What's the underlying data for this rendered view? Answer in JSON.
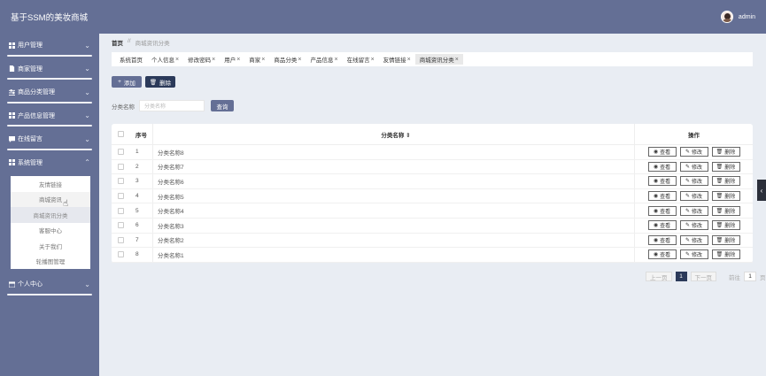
{
  "app": {
    "title": "基于SSM的美妆商城",
    "user": "admin"
  },
  "sidebar": {
    "items": [
      {
        "label": "用户管理",
        "icon": "grid-icon"
      },
      {
        "label": "商家管理",
        "icon": "file-icon"
      },
      {
        "label": "商品分类管理",
        "icon": "sliders-icon"
      },
      {
        "label": "产品信息管理",
        "icon": "grid-icon"
      },
      {
        "label": "在线留言",
        "icon": "chat-icon"
      },
      {
        "label": "系统管理",
        "icon": "grid-icon"
      },
      {
        "label": "个人中心",
        "icon": "calendar-icon"
      }
    ],
    "submenu": [
      "友情链接",
      "商城资讯",
      "商城资讯分类",
      "客服中心",
      "关于我们",
      "轮播图管理"
    ]
  },
  "breadcrumb": {
    "home": "首页",
    "sep": "//",
    "current": "商城资讯分类"
  },
  "tabs": [
    "系统首页",
    "个人信息",
    "修改密码",
    "用户",
    "商家",
    "商品分类",
    "产品信息",
    "在线留言",
    "友情链接",
    "商城资讯分类"
  ],
  "toolbar": {
    "add": "添加",
    "delete": "删除"
  },
  "search": {
    "label": "分类名称",
    "placeholder": "分类名称",
    "button": "查询"
  },
  "table": {
    "headers": {
      "no": "序号",
      "name": "分类名称 ⇕",
      "ops": "操作"
    },
    "rows": [
      {
        "no": "1",
        "name": "分类名称8"
      },
      {
        "no": "2",
        "name": "分类名称7"
      },
      {
        "no": "3",
        "name": "分类名称6"
      },
      {
        "no": "4",
        "name": "分类名称5"
      },
      {
        "no": "5",
        "name": "分类名称4"
      },
      {
        "no": "6",
        "name": "分类名称3"
      },
      {
        "no": "7",
        "name": "分类名称2"
      },
      {
        "no": "8",
        "name": "分类名称1"
      }
    ],
    "ops": {
      "view": "查看",
      "edit": "修改",
      "delete": "删除"
    }
  },
  "pagination": {
    "prev": "上一页",
    "current": "1",
    "next": "下一页",
    "goto": "前往",
    "page_input": "1",
    "unit": "页"
  },
  "colors": {
    "sidebar": "#646f95",
    "dark_button": "#2b3a5a",
    "background": "#e9edf3"
  }
}
